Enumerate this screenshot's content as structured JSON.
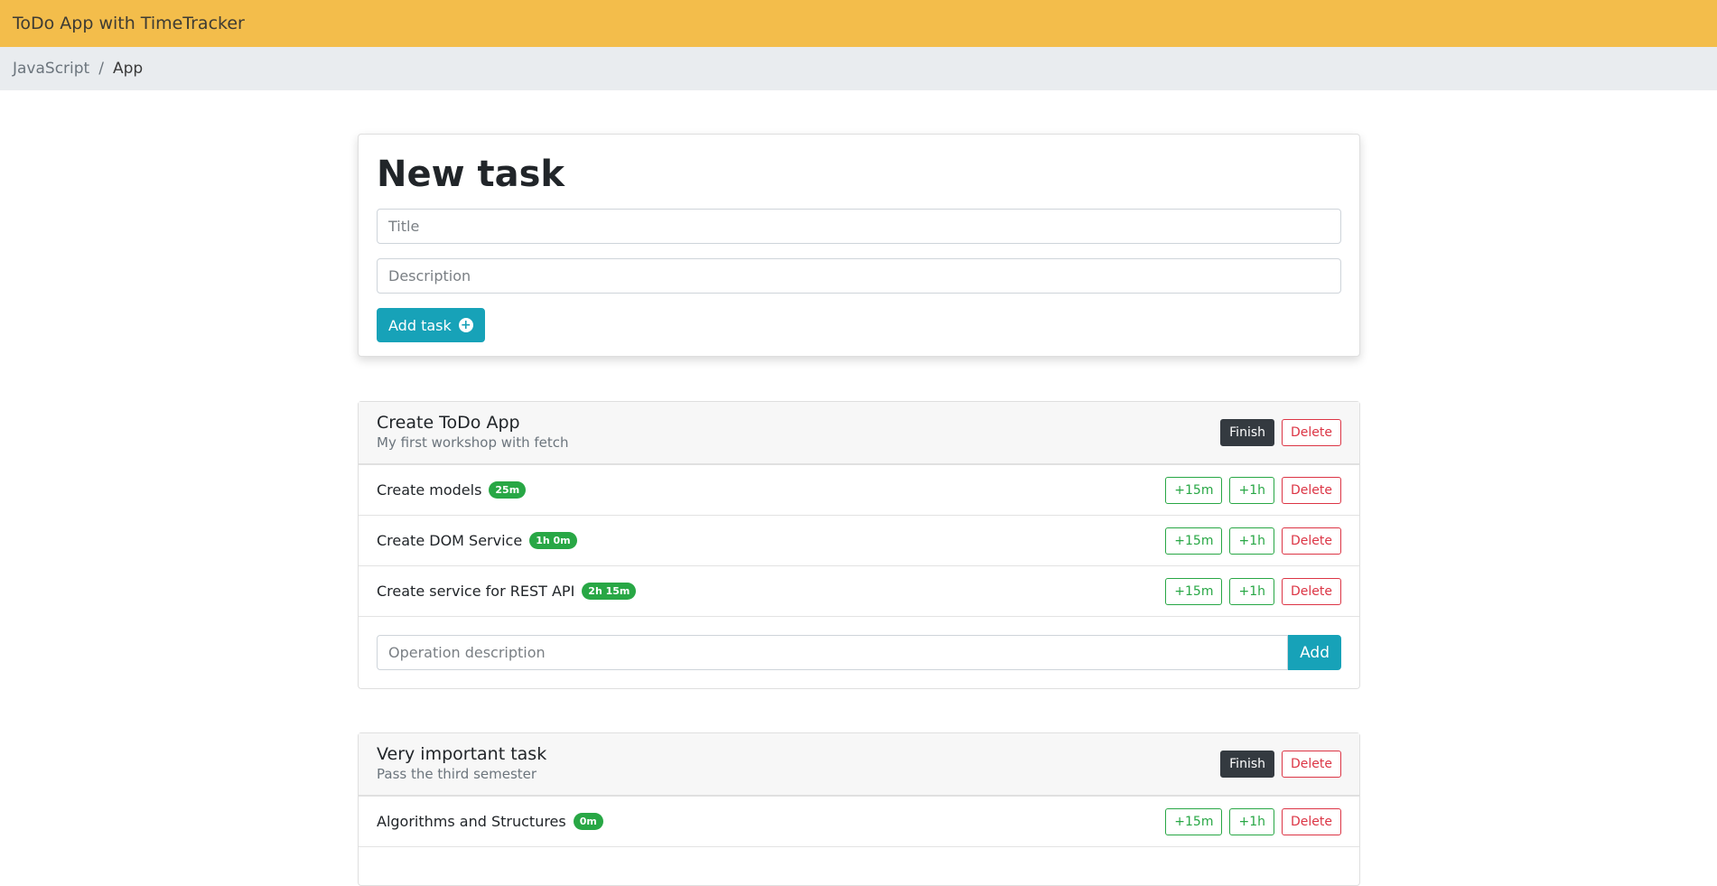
{
  "navbar": {
    "brand": "ToDo App with TimeTracker",
    "color": "#f3bd4b"
  },
  "breadcrumb": {
    "link": "JavaScript",
    "separator": "/",
    "active": "App"
  },
  "new_task": {
    "heading": "New task",
    "title_placeholder": "Title",
    "description_placeholder": "Description",
    "add_label": "Add task",
    "add_icon": "plus-circle-icon"
  },
  "tasks": [
    {
      "title": "Create ToDo App",
      "description": "My first workshop with fetch",
      "finish_label": "Finish",
      "delete_label": "Delete",
      "operations": [
        {
          "description": "Create models",
          "time": "25m",
          "plus15_label": "+15m",
          "plus1h_label": "+1h",
          "delete_label": "Delete"
        },
        {
          "description": "Create DOM Service",
          "time": "1h 0m",
          "plus15_label": "+15m",
          "plus1h_label": "+1h",
          "delete_label": "Delete"
        },
        {
          "description": "Create service for REST API",
          "time": "2h 15m",
          "plus15_label": "+15m",
          "plus1h_label": "+1h",
          "delete_label": "Delete"
        }
      ],
      "op_placeholder": "Operation description",
      "add_op_label": "Add"
    },
    {
      "title": "Very important task",
      "description": "Pass the third semester",
      "finish_label": "Finish",
      "delete_label": "Delete",
      "operations": [
        {
          "description": "Algorithms and Structures",
          "time": "0m",
          "plus15_label": "+15m",
          "plus1h_label": "+1h",
          "delete_label": "Delete"
        }
      ]
    }
  ]
}
